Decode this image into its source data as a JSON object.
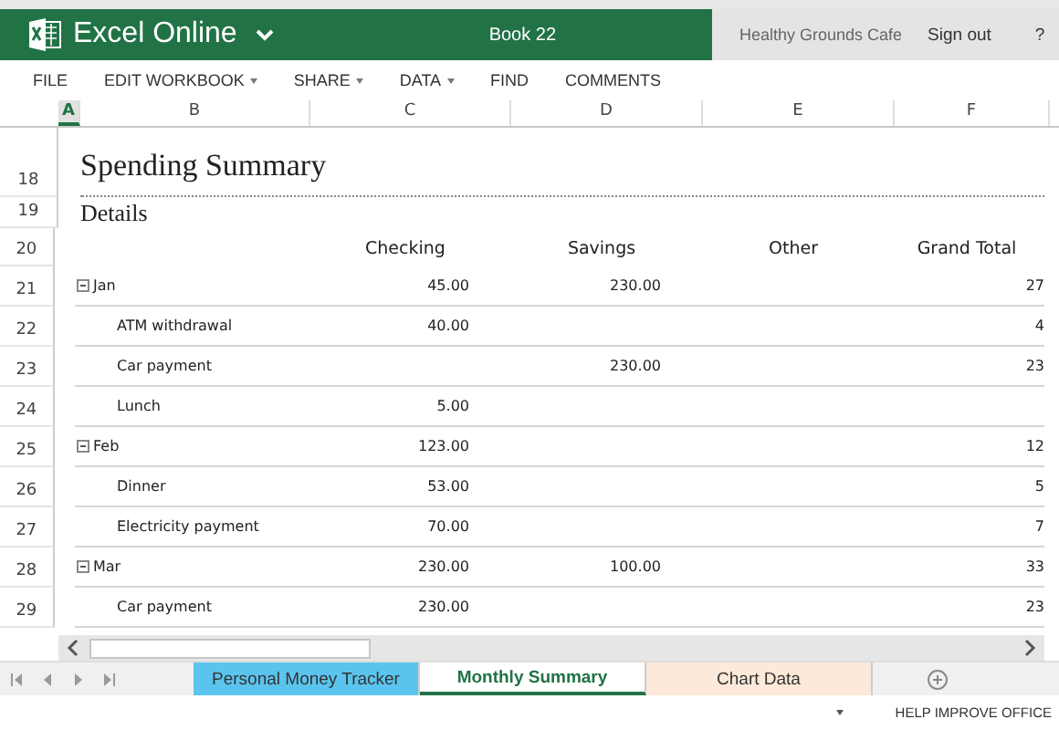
{
  "header": {
    "app_name": "Excel Online",
    "document": "Book 22",
    "account": "Healthy Grounds Cafe",
    "sign_out": "Sign out",
    "help": "?"
  },
  "menu": [
    {
      "label": "FILE",
      "has_menu": false
    },
    {
      "label": "EDIT WORKBOOK",
      "has_menu": true
    },
    {
      "label": "SHARE",
      "has_menu": true
    },
    {
      "label": "DATA",
      "has_menu": true
    },
    {
      "label": "FIND",
      "has_menu": false
    },
    {
      "label": "COMMENTS",
      "has_menu": false
    }
  ],
  "columns": [
    {
      "label": "A",
      "selected": true
    },
    {
      "label": "B",
      "selected": false
    },
    {
      "label": "C",
      "selected": false
    },
    {
      "label": "D",
      "selected": false
    },
    {
      "label": "E",
      "selected": false
    },
    {
      "label": "F",
      "selected": false
    }
  ],
  "sheet": {
    "title_row": "18",
    "title": "Spending Summary",
    "details_row": "19",
    "details": "Details",
    "header_row": "20",
    "headers": [
      "Checking",
      "Savings",
      "Other",
      "Grand Total"
    ],
    "rows": [
      {
        "row": "21",
        "kind": "group",
        "expanded": true,
        "label": "Jan",
        "values": {
          "checking": "45.00",
          "savings": "230.00",
          "grand_total": "27"
        }
      },
      {
        "row": "22",
        "kind": "item",
        "label": "ATM withdrawal",
        "values": {
          "checking": "40.00",
          "grand_total": "4"
        }
      },
      {
        "row": "23",
        "kind": "item",
        "label": "Car payment",
        "values": {
          "savings": "230.00",
          "grand_total": "23"
        }
      },
      {
        "row": "24",
        "kind": "item",
        "label": "Lunch",
        "values": {
          "checking": "5.00"
        }
      },
      {
        "row": "25",
        "kind": "group",
        "expanded": true,
        "label": "Feb",
        "values": {
          "checking": "123.00",
          "grand_total": "12"
        }
      },
      {
        "row": "26",
        "kind": "item",
        "label": "Dinner",
        "values": {
          "checking": "53.00",
          "grand_total": "5"
        }
      },
      {
        "row": "27",
        "kind": "item",
        "label": "Electricity payment",
        "values": {
          "checking": "70.00",
          "grand_total": "7"
        }
      },
      {
        "row": "28",
        "kind": "group",
        "expanded": true,
        "label": "Mar",
        "values": {
          "checking": "230.00",
          "savings": "100.00",
          "grand_total": "33"
        }
      },
      {
        "row": "29",
        "kind": "item",
        "label": "Car payment",
        "values": {
          "checking": "230.00",
          "grand_total": "23"
        }
      }
    ]
  },
  "sheet_tabs": [
    {
      "label": "Personal Money Tracker",
      "selected": false,
      "color": "#5bc4ee"
    },
    {
      "label": "Monthly Summary",
      "selected": true,
      "color": "#ffffff"
    },
    {
      "label": "Chart Data",
      "selected": false,
      "color": "#fde9d9"
    }
  ],
  "status_bar": {
    "help": "HELP IMPROVE OFFICE"
  }
}
